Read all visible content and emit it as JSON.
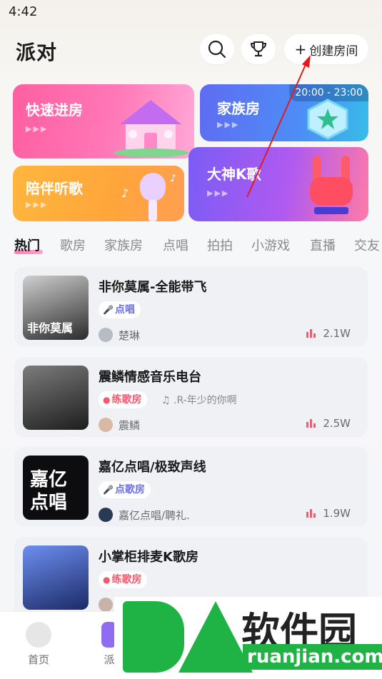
{
  "status_bar": {
    "time": "4:42"
  },
  "header": {
    "title": "派对",
    "search_icon": "search-icon",
    "trophy_icon": "trophy-icon",
    "create_label": "创建房间",
    "create_prefix": "+"
  },
  "banners": {
    "quick": {
      "title": "快速进房",
      "dots": "▶▶▶"
    },
    "family": {
      "title": "家族房",
      "dots": "▶▶▶",
      "time": "20:00 - 23:00"
    },
    "listen": {
      "title": "陪伴听歌",
      "dots": "▶▶▶"
    },
    "ktv": {
      "title": "大神K歌",
      "dots": "▶▶▶"
    }
  },
  "tabs": [
    "热门",
    "歌房",
    "家族房",
    "点唱",
    "拍拍",
    "小游戏",
    "直播",
    "交友"
  ],
  "active_tab": "热门",
  "rooms": [
    {
      "name": "非你莫属-全能带飞",
      "tag": "点唱",
      "tag_color": "#6a6fe6",
      "song": "",
      "host": "楚琳",
      "heat": "2.1W",
      "cover_text": "非你莫属"
    },
    {
      "name": "震鳞情感音乐电台",
      "tag": "练歌房",
      "tag_color": "#f15a6e",
      "song": "♫ .R-年少的你啊",
      "host": "震鳞",
      "heat": "2.5W",
      "cover_text": ""
    },
    {
      "name": "嘉亿点唱/极致声线",
      "tag": "点歌房",
      "tag_color": "#6a6fe6",
      "song": "",
      "host": "嘉亿点唱/聘礼.",
      "heat": "1.9W",
      "cover_text": "嘉亿点唱"
    },
    {
      "name": "小掌柜排麦K歌房",
      "tag": "练歌房",
      "tag_color": "#f15a6e",
      "song": "",
      "host": "",
      "heat": "",
      "cover_text": ""
    }
  ],
  "bottom_nav": [
    {
      "label": "首页"
    },
    {
      "label": "派"
    }
  ],
  "watermark": {
    "cn": "软件园",
    "en": "ruanjian.com"
  },
  "colors": {
    "accent_pink": "#ff5fa0",
    "heat_red": "#f45a6f"
  }
}
